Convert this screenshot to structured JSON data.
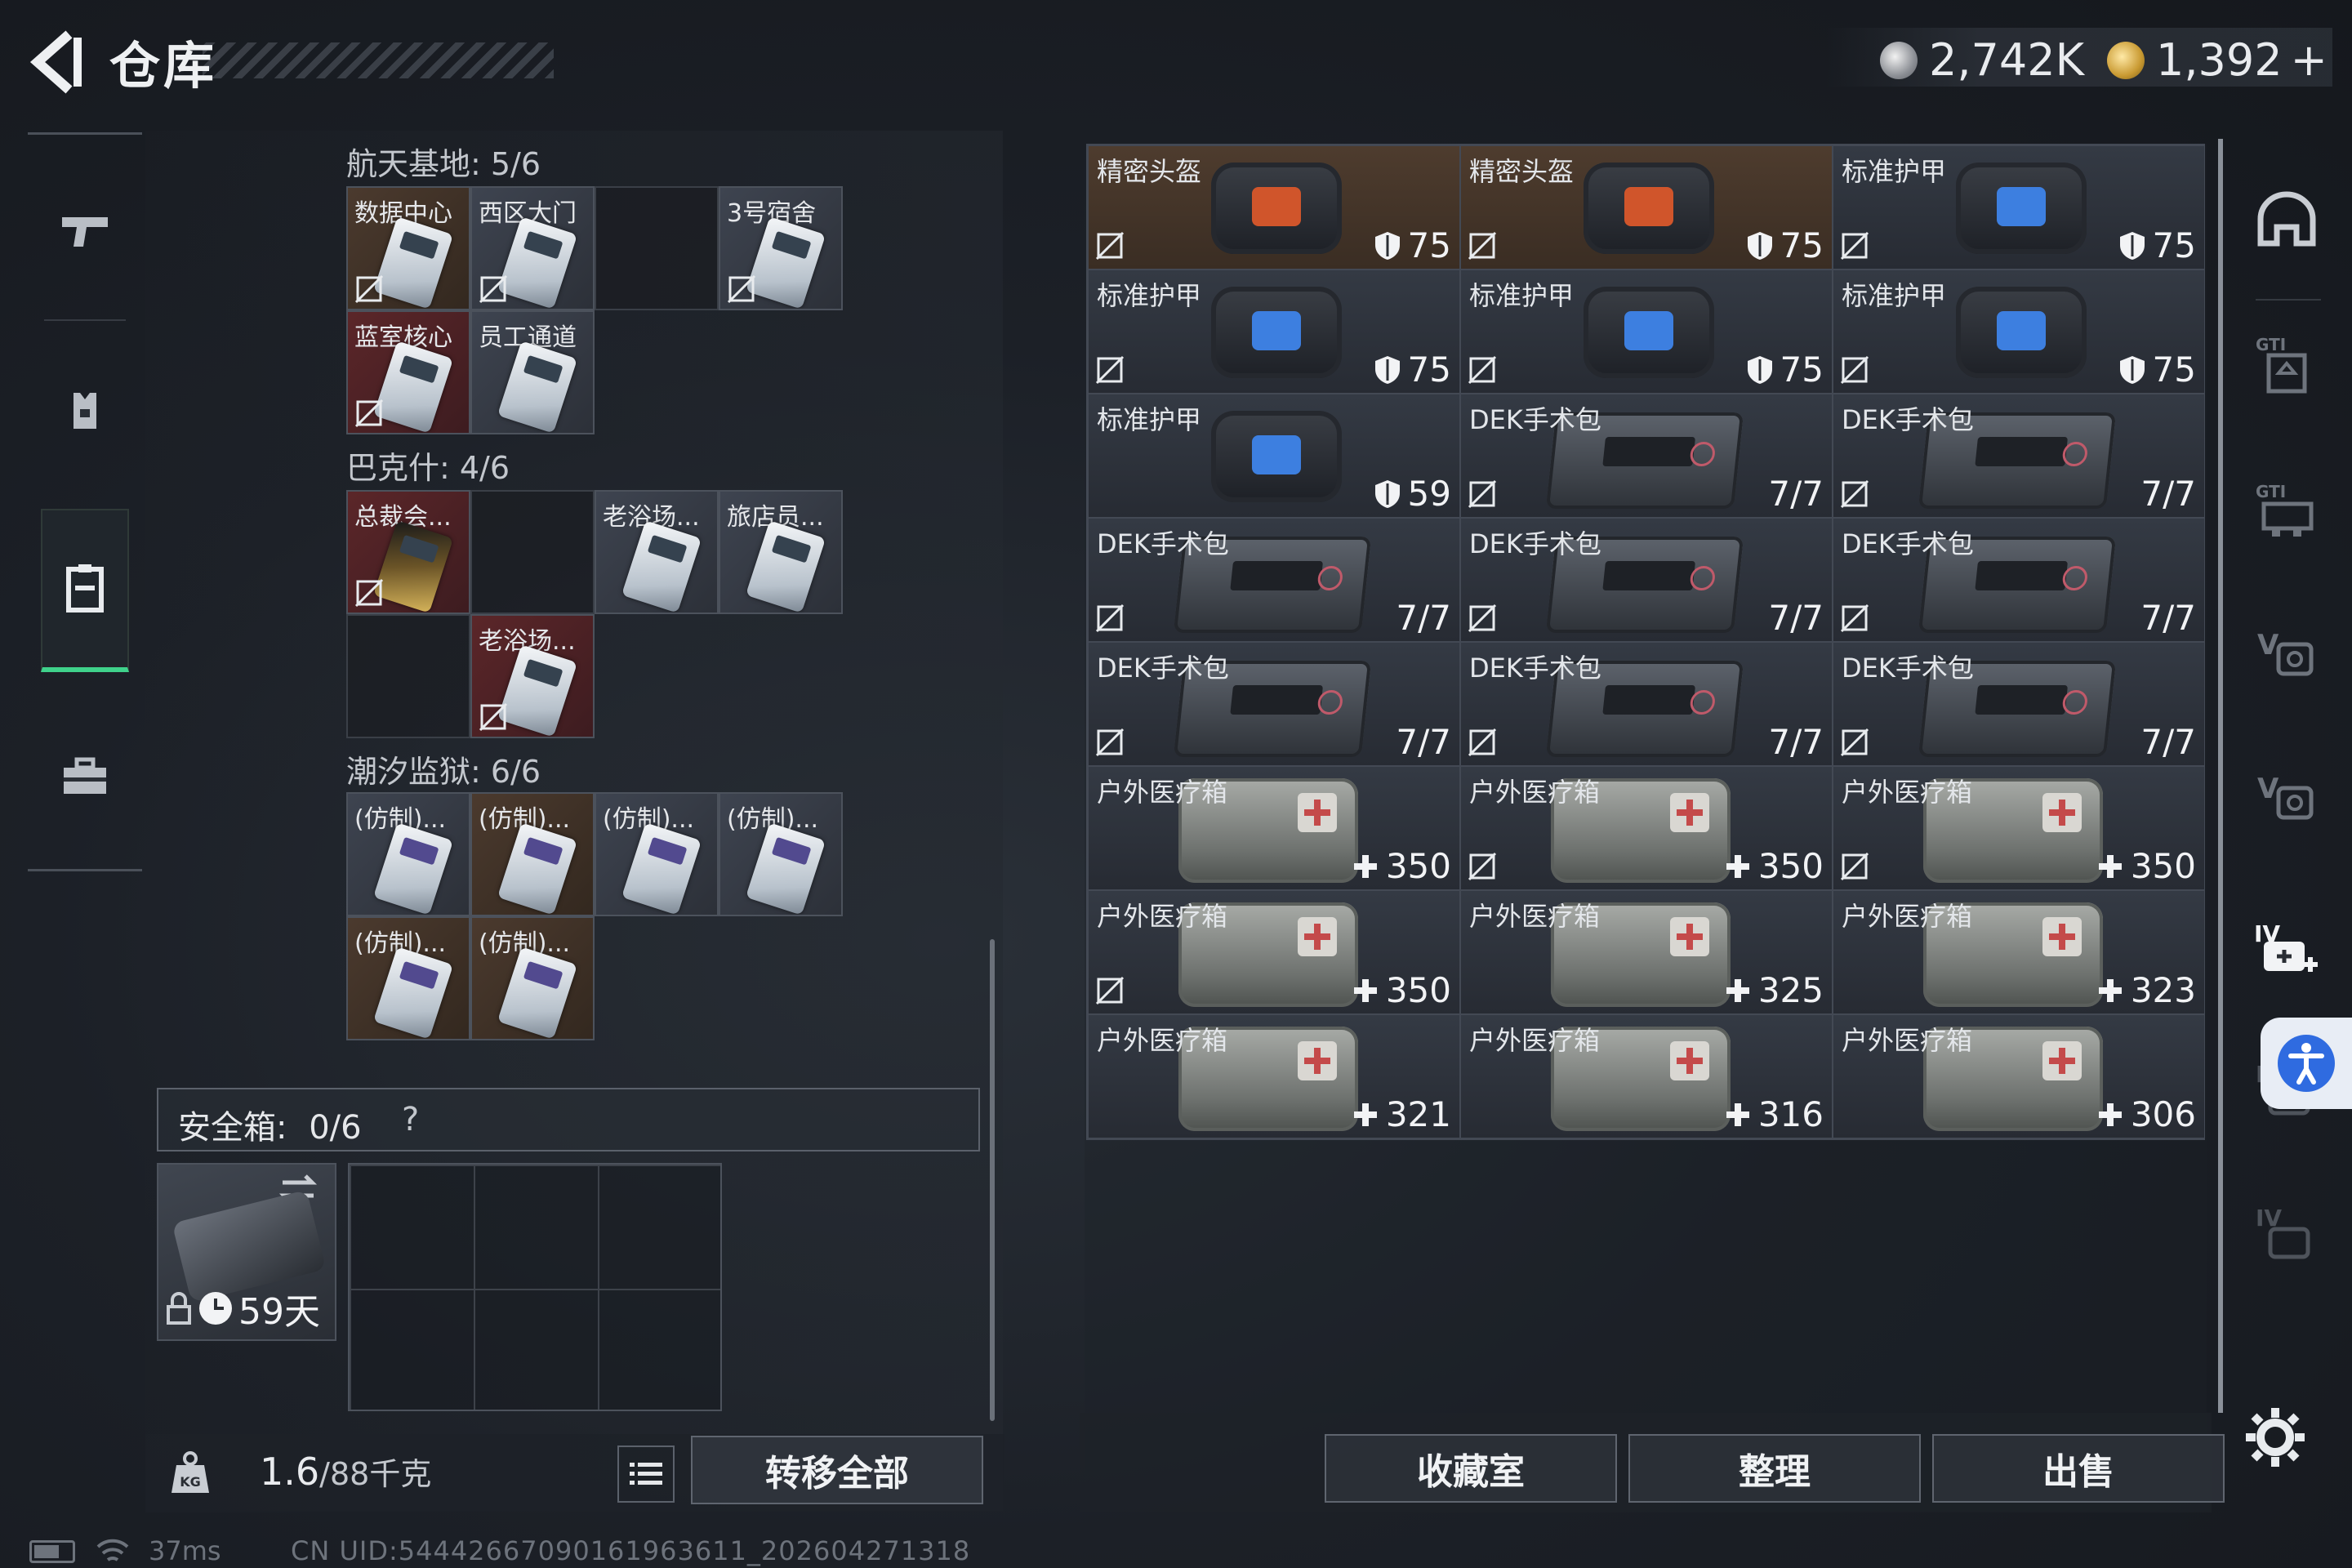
{
  "header": {
    "title": "仓库",
    "currency_silver": "2,742K",
    "currency_gold": "1,392",
    "currency_plus": "+"
  },
  "stash": {
    "sections": [
      {
        "title": "航天基地: 5/6"
      },
      {
        "title": "巴克什: 4/6"
      },
      {
        "title": "潮汐监狱: 6/6"
      }
    ],
    "aerospace": [
      "数据中心",
      "西区大门",
      "3号宿舍",
      "蓝室核心",
      "员工通道"
    ],
    "bakesh": [
      "总裁会...",
      "老浴场...",
      "旅店员...",
      "老浴场..."
    ],
    "tide": [
      "(仿制)...",
      "(仿制)...",
      "(仿制)...",
      "(仿制)...",
      "(仿制)...",
      "(仿制)..."
    ]
  },
  "safe_box": {
    "label": "安全箱:",
    "count": "0/6",
    "help": "?",
    "timer": "59天"
  },
  "weight": {
    "current": "1.6",
    "max": "/88千克"
  },
  "buttons": {
    "transfer_all": "转移全部",
    "collection": "收藏室",
    "organize": "整理",
    "sell": "出售"
  },
  "inventory": [
    {
      "name": "精密头盔",
      "value": "75",
      "kind": "armor",
      "bg": "brown",
      "plate": "#d0552b",
      "prefix": "shield"
    },
    {
      "name": "精密头盔",
      "value": "75",
      "kind": "armor",
      "bg": "brown",
      "plate": "#d0552b",
      "prefix": "shield"
    },
    {
      "name": "标准护甲",
      "value": "75",
      "kind": "armor",
      "bg": "gray",
      "plate": "#3d7fe0",
      "prefix": "shield"
    },
    {
      "name": "标准护甲",
      "value": "75",
      "kind": "armor",
      "bg": "gray",
      "plate": "#3d7fe0",
      "prefix": "shield"
    },
    {
      "name": "标准护甲",
      "value": "75",
      "kind": "armor",
      "bg": "gray",
      "plate": "#3d7fe0",
      "prefix": "shield"
    },
    {
      "name": "标准护甲",
      "value": "75",
      "kind": "armor",
      "bg": "gray",
      "plate": "#3d7fe0",
      "prefix": "shield"
    },
    {
      "name": "标准护甲",
      "value": "59",
      "kind": "armor",
      "bg": "gray",
      "plate": "#3d7fe0",
      "prefix": "shield"
    },
    {
      "name": "DEK手术包",
      "value": "7/7",
      "kind": "kit",
      "bg": "gray",
      "prefix": ""
    },
    {
      "name": "DEK手术包",
      "value": "7/7",
      "kind": "kit",
      "bg": "gray",
      "prefix": ""
    },
    {
      "name": "DEK手术包",
      "value": "7/7",
      "kind": "kit",
      "bg": "gray",
      "prefix": ""
    },
    {
      "name": "DEK手术包",
      "value": "7/7",
      "kind": "kit",
      "bg": "gray",
      "prefix": ""
    },
    {
      "name": "DEK手术包",
      "value": "7/7",
      "kind": "kit",
      "bg": "gray",
      "prefix": ""
    },
    {
      "name": "DEK手术包",
      "value": "7/7",
      "kind": "kit",
      "bg": "gray",
      "prefix": ""
    },
    {
      "name": "DEK手术包",
      "value": "7/7",
      "kind": "kit",
      "bg": "gray",
      "prefix": ""
    },
    {
      "name": "DEK手术包",
      "value": "7/7",
      "kind": "kit",
      "bg": "gray",
      "prefix": ""
    },
    {
      "name": "户外医疗箱",
      "value": "350",
      "kind": "med",
      "bg": "gray",
      "prefix": "plus"
    },
    {
      "name": "户外医疗箱",
      "value": "350",
      "kind": "med",
      "bg": "gray",
      "prefix": "plus"
    },
    {
      "name": "户外医疗箱",
      "value": "350",
      "kind": "med",
      "bg": "gray",
      "prefix": "plus"
    },
    {
      "name": "户外医疗箱",
      "value": "350",
      "kind": "med",
      "bg": "gray",
      "prefix": "plus"
    },
    {
      "name": "户外医疗箱",
      "value": "325",
      "kind": "med",
      "bg": "gray",
      "prefix": "plus"
    },
    {
      "name": "户外医疗箱",
      "value": "323",
      "kind": "med",
      "bg": "gray",
      "prefix": "plus"
    },
    {
      "name": "户外医疗箱",
      "value": "321",
      "kind": "med",
      "bg": "gray",
      "prefix": "plus"
    },
    {
      "name": "户外医疗箱",
      "value": "316",
      "kind": "med",
      "bg": "gray",
      "prefix": "plus"
    },
    {
      "name": "户外医疗箱",
      "value": "306",
      "kind": "med",
      "bg": "gray",
      "prefix": "plus"
    }
  ],
  "status": {
    "ping": "37ms",
    "uid": "CN UID:54442667090161963611_202604271318"
  }
}
